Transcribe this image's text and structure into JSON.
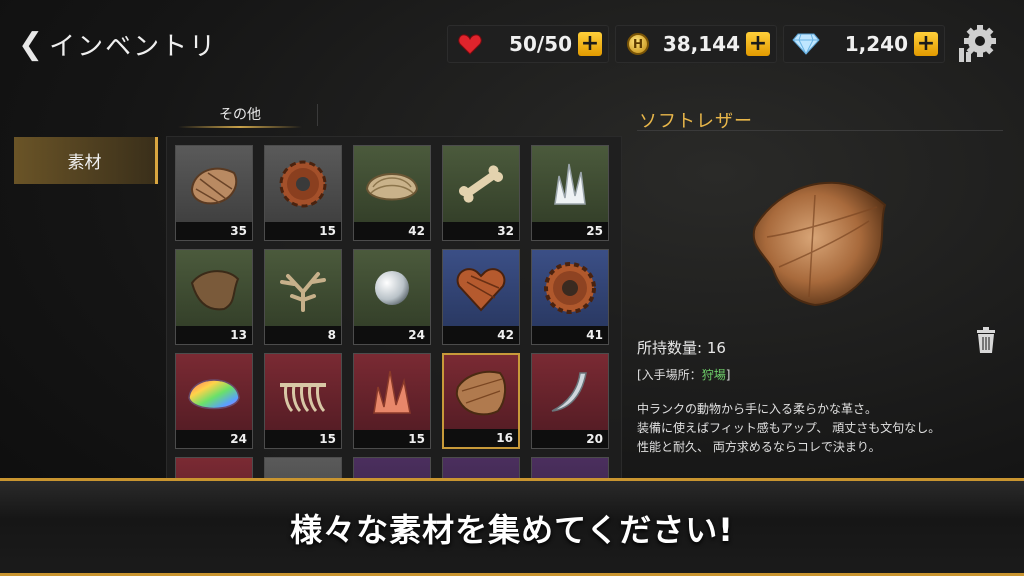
{
  "header": {
    "back_label": "インベントリ"
  },
  "resources": [
    {
      "icon": "heart-icon",
      "value": "50/50"
    },
    {
      "icon": "coin-icon",
      "coin_letter": "H",
      "value": "38,144"
    },
    {
      "icon": "diamond-icon",
      "value": "1,240"
    }
  ],
  "tabs": {
    "other": "その他"
  },
  "sidebar": {
    "category": "素材"
  },
  "items": [
    {
      "name": "shell-fragment",
      "count": "35",
      "bg": "g"
    },
    {
      "name": "rusty-gear",
      "count": "15",
      "bg": "g"
    },
    {
      "name": "clam-shell",
      "count": "42",
      "bg": "gr"
    },
    {
      "name": "bone",
      "count": "32",
      "bg": "gr"
    },
    {
      "name": "white-crystal",
      "count": "25",
      "bg": "gr"
    },
    {
      "name": "hide-scrap",
      "count": "13",
      "bg": "gr"
    },
    {
      "name": "antler",
      "count": "8",
      "bg": "gr"
    },
    {
      "name": "pearl",
      "count": "24",
      "bg": "gr"
    },
    {
      "name": "heart-gem",
      "count": "42",
      "bg": "bl"
    },
    {
      "name": "bronze-gear",
      "count": "41",
      "bg": "bl"
    },
    {
      "name": "rainbow-shell",
      "count": "24",
      "bg": "rd"
    },
    {
      "name": "ribcage",
      "count": "15",
      "bg": "rd"
    },
    {
      "name": "red-crystal",
      "count": "15",
      "bg": "rd"
    },
    {
      "name": "soft-leather",
      "count": "16",
      "bg": "rd",
      "selected": true
    },
    {
      "name": "fang",
      "count": "20",
      "bg": "rd"
    },
    {
      "name": "partial-1",
      "count": "",
      "bg": "rd"
    },
    {
      "name": "partial-2",
      "count": "",
      "bg": "g"
    },
    {
      "name": "partial-3",
      "count": "",
      "bg": "pu"
    },
    {
      "name": "partial-4",
      "count": "",
      "bg": "pu"
    },
    {
      "name": "partial-5",
      "count": "",
      "bg": "pu"
    }
  ],
  "detail": {
    "title": "ソフトレザー",
    "quantity": "所持数量: 16",
    "source_prefix": "[入手場所：",
    "source_place": "狩場",
    "source_suffix": "]",
    "description": [
      "中ランクの動物から手に入る柔らかな革さ。",
      "装備に使えばフィット感もアップ、 頑丈さも文句なし。",
      "性能と耐久、 両方求めるならコレで決まり。"
    ]
  },
  "banner": {
    "text": "様々な素材を集めてください!"
  },
  "colors": {
    "accent": "#e9b74a",
    "gold_border": "#c99530",
    "source_highlight": "#6fd06a"
  }
}
